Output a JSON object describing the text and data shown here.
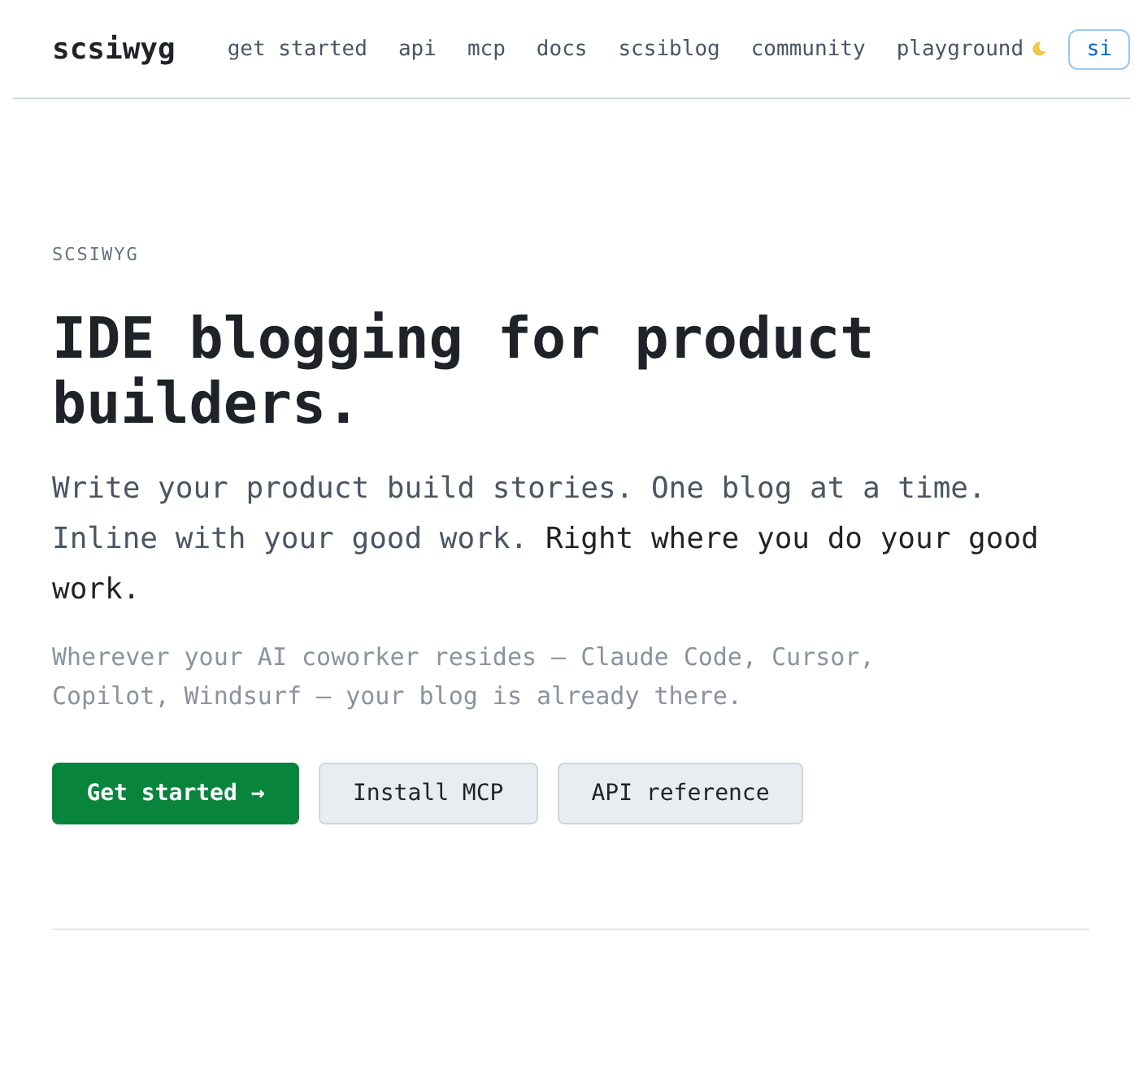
{
  "header": {
    "logo": "scsiwyg",
    "nav": [
      "get started",
      "api",
      "mcp",
      "docs",
      "scsiblog",
      "community",
      "playground"
    ],
    "cut_button": "si"
  },
  "hero": {
    "eyebrow": "SCSIWYG",
    "title": "IDE blogging for product builders.",
    "tagline": {
      "text": "Write your product build stories. One blog at a time. Inline with your good work.",
      "highlight": "Right where you do your good work."
    },
    "note": "Wherever your AI coworker resides — Claude Code, Cursor, Copilot, Windsurf — your blog is already there.",
    "buttons": [
      {
        "label": "Get started →",
        "kind": "primary"
      },
      {
        "label": "Install MCP",
        "kind": "secondary"
      },
      {
        "label": "API reference",
        "kind": "secondary"
      }
    ]
  }
}
